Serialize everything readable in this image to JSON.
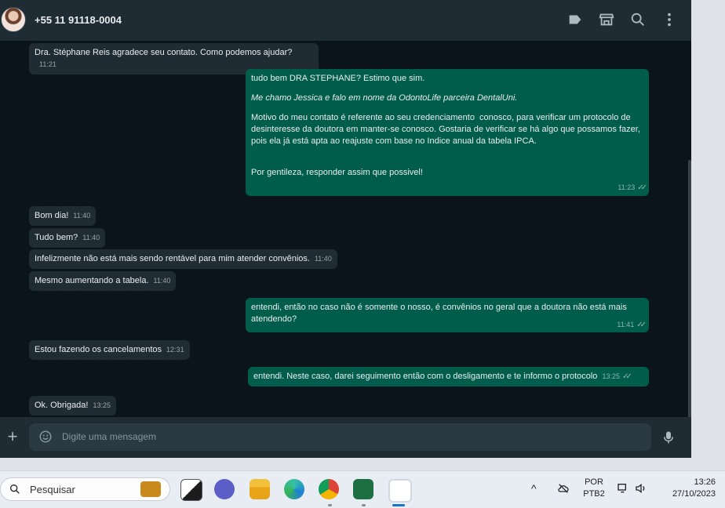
{
  "header": {
    "contact": "+55 11 91118-0004",
    "icons": [
      "label-icon",
      "store-icon",
      "search-icon",
      "menu-icon"
    ]
  },
  "messages": [
    {
      "id": "m1",
      "direction": "in",
      "text": "Dra. Stéphane Reis agradece seu contato. Como podemos ajudar?",
      "time": "11:21"
    },
    {
      "id": "m2",
      "direction": "out",
      "paragraphs": [
        "tudo bem DRA STEPHANE? Estimo que sim.",
        "Me chamo Jessica e falo em nome da OdontoLife parceira DentalUni.",
        "Motivo do meu contato é referente ao seu credenciamento  conosco, para verificar um protocolo de desinteresse da doutora em manter-se conosco. Gostaria de verificar se há algo que possamos fazer, pois ela já está apta ao reajuste com base no Indice anual da tabela IPCA.",
        "Por gentileza, responder assim que possivel!"
      ],
      "time": "11:23"
    },
    {
      "id": "m3",
      "direction": "in",
      "text": "Bom dia!",
      "time": "11:40"
    },
    {
      "id": "m4",
      "direction": "in",
      "text": "Tudo bem?",
      "time": "11:40"
    },
    {
      "id": "m5",
      "direction": "in",
      "text": "Infelizmente não está mais sendo rentável para mim atender convênios.",
      "time": "11:40"
    },
    {
      "id": "m6",
      "direction": "in",
      "text": "Mesmo aumentando a tabela.",
      "time": "11:40"
    },
    {
      "id": "m7",
      "direction": "out",
      "text": "entendi, então no caso não é somente o nosso, é convênios no geral que a doutora não está mais atendendo?",
      "time": "11:41"
    },
    {
      "id": "m8",
      "direction": "in",
      "text": "Estou fazendo os cancelamentos",
      "time": "12:31"
    },
    {
      "id": "m9",
      "direction": "out",
      "text": "entendi. Neste caso, darei seguimento então com o desligamento e te informo o protocolo",
      "time": "13:25"
    },
    {
      "id": "m10",
      "direction": "in",
      "text": "Ok. Obrigada!",
      "time": "13:25"
    }
  ],
  "composer": {
    "placeholder": "Digite uma mensagem"
  },
  "taskbar": {
    "search_placeholder": "Pesquisar",
    "language": "POR",
    "layout": "PTB2",
    "time": "13:26",
    "date": "27/10/2023"
  },
  "colors": {
    "incoming": "#202c33",
    "outgoing": "#005c4b",
    "background": "#0b141a"
  }
}
